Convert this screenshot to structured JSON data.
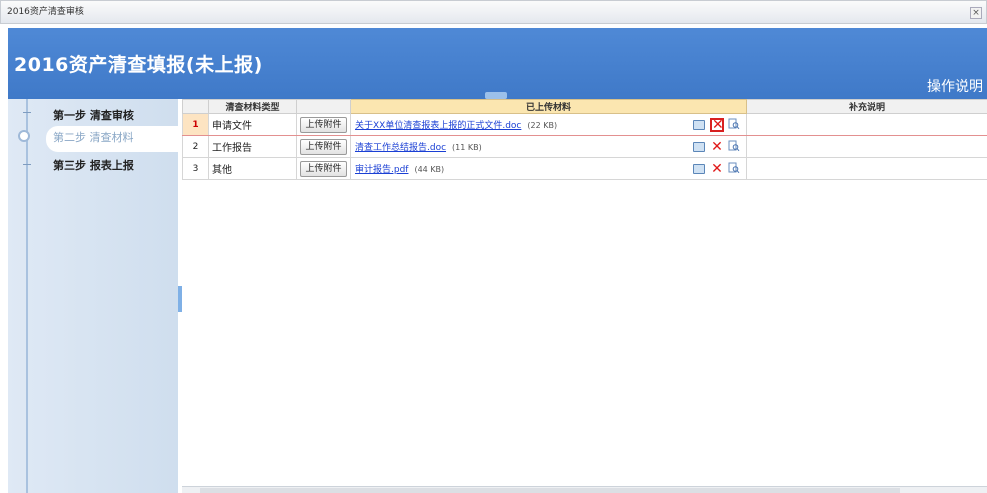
{
  "window": {
    "tab_title": "2016资产清查审核",
    "close_label": "×"
  },
  "banner": {
    "title": "2016资产清查填报(未上报)",
    "help_link": "操作说明"
  },
  "steps": [
    {
      "label": "第一步 清查审核"
    },
    {
      "label": "第二步 清查材料"
    },
    {
      "label": "第三步 报表上报"
    }
  ],
  "table": {
    "headers": {
      "num": "",
      "type": "清查材料类型",
      "upload": "",
      "uploaded": "已上传材料",
      "note": "补充说明"
    },
    "upload_button": "上传附件",
    "rows": [
      {
        "num": "1",
        "type": "申请文件",
        "file": "关于XX单位清查报表上报的正式文件.doc",
        "size": "(22 KB)",
        "note": ""
      },
      {
        "num": "2",
        "type": "工作报告",
        "file": "清查工作总结报告.doc",
        "size": "(11 KB)",
        "note": ""
      },
      {
        "num": "3",
        "type": "其他",
        "file": "审计报告.pdf",
        "size": "(44 KB)",
        "note": ""
      }
    ]
  },
  "icons": {
    "edit": "edit-icon",
    "delete": "delete-icon",
    "preview": "preview-icon"
  },
  "colors": {
    "banner": "#4a84d2",
    "link": "#1a3fd4",
    "delete": "#e01818",
    "uploaded_header": "#fbe6b0"
  }
}
